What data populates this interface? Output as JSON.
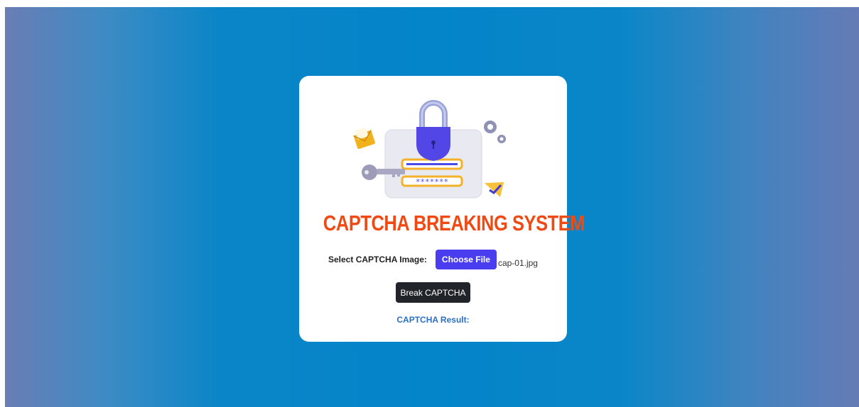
{
  "title": "CAPTCHA BREAKING SYSTEM",
  "form": {
    "file_label": "Select CAPTCHA Image:",
    "choose_label": "Choose File",
    "file_name": "cap-01.jpg",
    "submit_label": "Break CAPTCHA"
  },
  "result": {
    "label": "CAPTCHA Result:"
  },
  "illustration": {
    "icons": [
      "padlock-icon",
      "login-form-icon",
      "password-field-icon",
      "key-icon",
      "envelope-icon",
      "gear-icon",
      "warning-check-icon"
    ],
    "password_mask": "*******"
  },
  "colors": {
    "title": "#f04a14",
    "choose_button": "#4a3df0",
    "submit_button": "#212529",
    "result_text": "#2a6fc4"
  }
}
